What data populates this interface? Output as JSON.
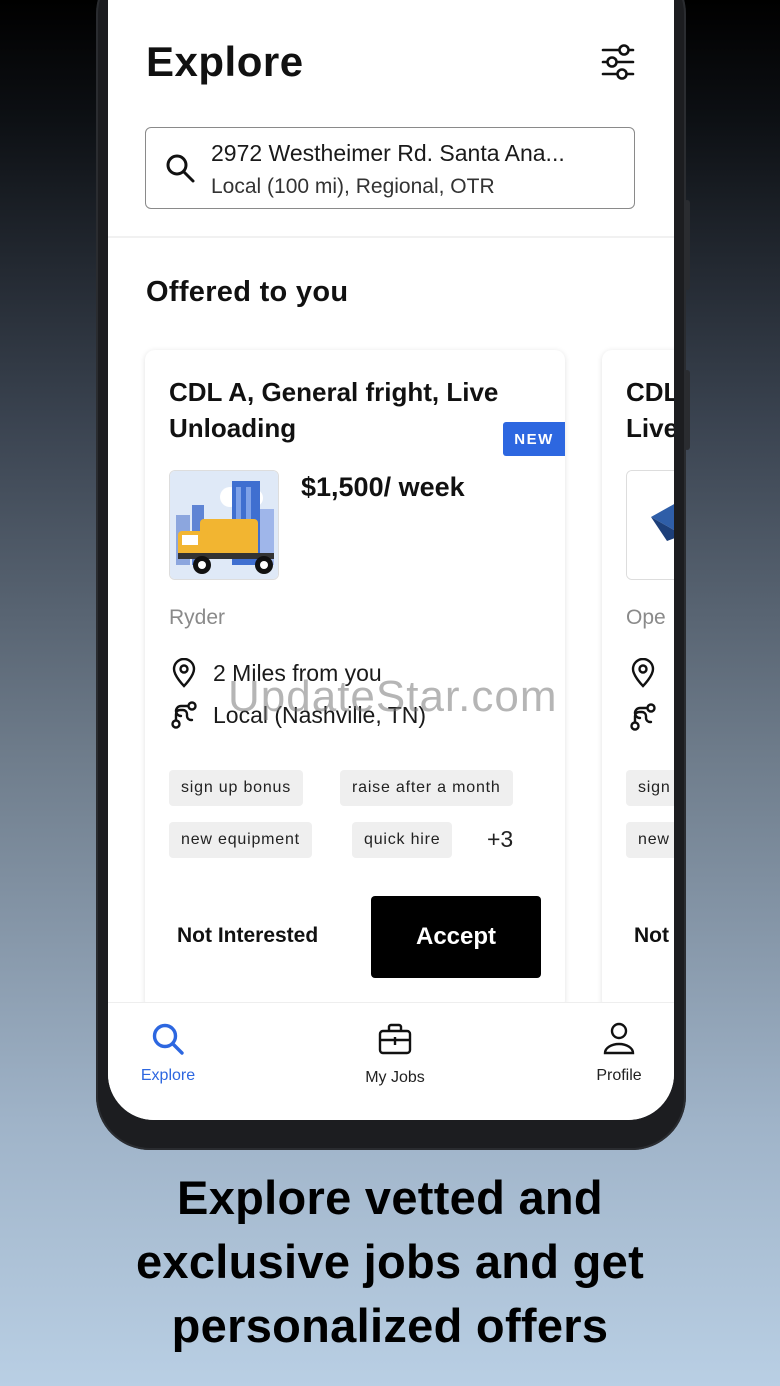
{
  "header": {
    "title": "Explore"
  },
  "search": {
    "address": "2972 Westheimer Rd. Santa Ana...",
    "filters": "Local (100 mi), Regional, OTR"
  },
  "section": {
    "title": "Offered to you"
  },
  "cards": [
    {
      "title": "CDL A, General fright, Live Unloading",
      "badge": "NEW",
      "salary": "$1,500/ week",
      "company": "Ryder",
      "distance": "2 Miles from you",
      "route": "Local (Nashville, TN)",
      "tags": [
        "sign up bonus",
        "raise after a month",
        "new equipment",
        "quick hire"
      ],
      "more": "+3",
      "not_interested": "Not Interested",
      "accept": "Accept"
    },
    {
      "title_partial_1": "CDL",
      "title_partial_2": "Live",
      "company_partial": "Ope",
      "tag_partial_1": "sign",
      "tag_partial_2": "new",
      "not_interested_partial": "Not"
    }
  ],
  "nav": {
    "items": [
      {
        "label": "Explore",
        "icon": "search-icon",
        "active": true
      },
      {
        "label": "My Jobs",
        "icon": "briefcase-icon",
        "active": false
      },
      {
        "label": "Profile",
        "icon": "person-icon",
        "active": false
      }
    ]
  },
  "watermark": "UpdateStar.com",
  "caption": {
    "line1": "Explore vetted and",
    "line2": "exclusive jobs and get",
    "line3": "personalized offers"
  },
  "colors": {
    "accent": "#2d67e0",
    "primary_button": "#000000"
  }
}
